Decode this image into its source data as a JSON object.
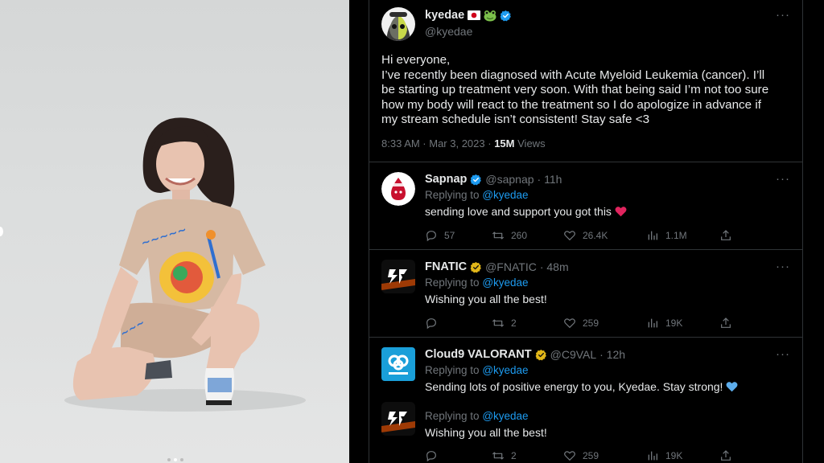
{
  "main_tweet": {
    "name": "kyedae",
    "handle": "@kyedae",
    "text_lines": [
      "Hi everyone,",
      "I’ve recently been diagnosed with Acute Myeloid Leukemia (cancer). I’ll",
      "be starting up treatment very soon. With that being said I’m not too sure",
      "how my body will react to the treatment so I do apologize in advance if",
      "my stream schedule isn’t consistent! Stay safe <3"
    ],
    "timestamp": "8:33 AM · Mar 3, 2023 ·",
    "views_count": "15M",
    "views_label": "Views",
    "more": "···"
  },
  "replies": [
    {
      "name": "Sapnap",
      "handle": "@sapnap",
      "time": "· 11h",
      "replying_label": "Replying to",
      "replying_to": "@kyedae",
      "text": "sending love and support you got this",
      "replies": "57",
      "retweets": "260",
      "likes": "26.4K",
      "views": "1.1M",
      "badge": "blue"
    },
    {
      "name": "FNATIC",
      "handle": "@FNATIC",
      "time": "· 48m",
      "replying_label": "Replying to",
      "replying_to": "@kyedae",
      "text": "Wishing you all the best!",
      "replies": "",
      "retweets": "2",
      "likes": "259",
      "views": "19K",
      "badge": "gold"
    },
    {
      "name": "Cloud9 VALORANT",
      "handle": "@C9VAL",
      "time": "· 12h",
      "replying_label": "Replying to",
      "replying_to": "@kyedae",
      "text": "Sending lots of positive energy to you, Kyedae. Stay strong!",
      "badge": "gold"
    },
    {
      "replying_label": "Replying to",
      "replying_to": "@kyedae",
      "text": "Wishing you all the best!",
      "replies": "",
      "retweets": "2",
      "likes": "259",
      "views": "19K"
    }
  ],
  "colors": {
    "background": "#000000",
    "text": "#e7e9ea",
    "muted": "#71767b",
    "link": "#1d9bf0",
    "verified_blue": "#1d9bf0",
    "verified_gold": "#e2b719",
    "border": "#2f3336",
    "photo_background": "#d8dada"
  },
  "icons": [
    "verified-badge-icon",
    "more-icon",
    "reply-icon",
    "retweet-icon",
    "like-icon",
    "views-icon",
    "share-icon",
    "red-heart-emoji",
    "blue-heart-emoji",
    "japan-flag-emoji",
    "frog-emoji"
  ]
}
